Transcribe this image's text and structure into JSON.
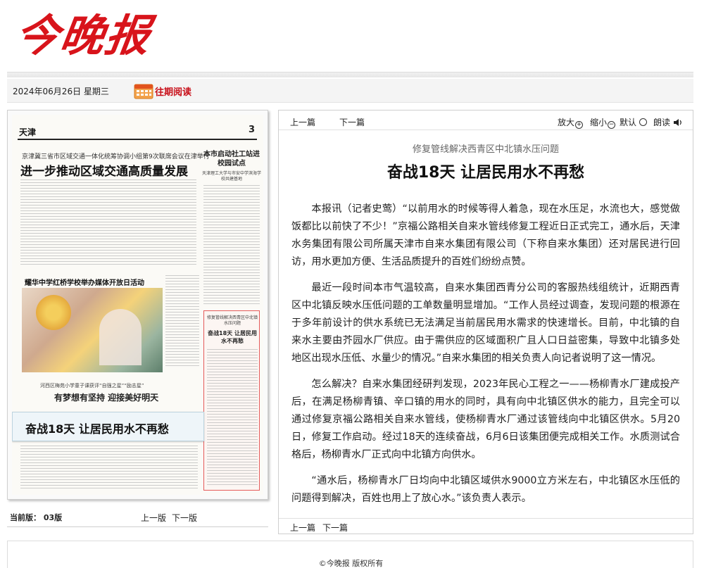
{
  "masthead": {
    "logo_text": "今晚报"
  },
  "datebar": {
    "date": "2024年06月26日 星期三",
    "past_issues": "往期阅读"
  },
  "paper": {
    "section": "天津",
    "page_number": "3",
    "kicker": "京津冀三省市区域交通一体化统筹协调小组第9次联席会议在津举行",
    "headline": "进一步推动区域交通高质量发展",
    "side_headline": "本市启动社工站进校园试点",
    "side_sub": "天津理工大学与市安中学滨海学校共建基地",
    "photo_headline": "耀华中学红桥学校举办媒体开放日活动",
    "highlight_kicker": "修复管线解决西青区中北镇水压问题",
    "highlight_title": "奋战18天 让居民用水不再愁",
    "bottom_kicker": "河西区梅苑小学童子课获评“自强之星”“励志星”",
    "bottom_headline": "有梦想有坚持 迎接美好明天",
    "hover_label": "奋战18天 让居民用水不再愁"
  },
  "edition": {
    "current_label": "当前版：",
    "current_value": "03版",
    "prev": "上一版",
    "next": "下一版"
  },
  "article": {
    "nav_prev": "上一篇",
    "nav_next": "下一篇",
    "zoom_in": "放大",
    "zoom_out": "缩小",
    "default": "默认",
    "read_aloud": "朗读",
    "kicker": "修复管线解决西青区中北镇水压问题",
    "title": "奋战18天  让居民用水不再愁",
    "paragraphs": [
      "本报讯（记者史莺）“以前用水的时候等得人着急，现在水压足，水流也大，感觉做饭都比以前快了不少！”京福公路相关自来水管线修复工程近日正式完工，通水后，天津水务集团有限公司所属天津市自来水集团有限公司（下称自来水集团）还对居民进行回访，用水更加方便、生活品质提升的百姓们纷纷点赞。",
      "最近一段时间本市气温较高，自来水集团西青分公司的客服热线组统计，近期西青区中北镇反映水压低问题的工单数量明显增加。“工作人员经过调查，发现问题的根源在于多年前设计的供水系统已无法满足当前居民用水需求的快速增长。目前，中北镇的自来水主要由芥园水厂供应。由于需供应的区域面积广且人口日益密集，导致中北镇多处地区出现水压低、水量少的情况。”自来水集团的相关负责人向记者说明了这一情况。",
      "怎么解决？自来水集团经研判发现，2023年民心工程之一——杨柳青水厂建成投产后，在满足杨柳青镇、辛口镇的用水的同时，具有向中北镇区供水的能力，且完全可以通过修复京福公路相关自来水管线，使杨柳青水厂通过该管线向中北镇区供水。5月20日，修复工作启动。经过18天的连续奋战，6月6日该集团便完成相关工作。水质测试合格后，杨柳青水厂正式向中北镇方向供水。",
      "“通水后，杨柳青水厂日均向中北镇区域供水9000立方米左右，中北镇区水压低的问题得到解决，百姓也用上了放心水。”该负责人表示。"
    ],
    "bottom_prev": "上一篇",
    "bottom_next": "下一篇"
  },
  "footer": {
    "copyright": "©今晚报 版权所有"
  },
  "colors": {
    "brand_red": "#d8141b",
    "link_red": "#c8101a",
    "highlight_border": "#e55a5a"
  }
}
